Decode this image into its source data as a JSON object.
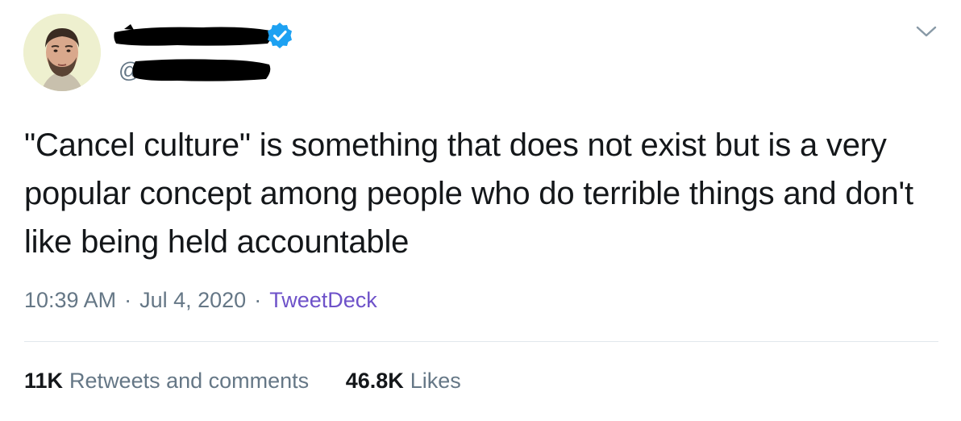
{
  "tweet": {
    "author": {
      "handle_prefix": "@",
      "verified_icon": "verified-badge-icon",
      "avatar_icon": "profile-photo"
    },
    "menu_icon": "chevron-down-icon",
    "text": "\"Cancel culture\" is something that does not exist but is a very popular concept among people who do terrible things and don't like being held accountable",
    "time": "10:39 AM",
    "separator": "·",
    "date": "Jul 4, 2020",
    "source": "TweetDeck",
    "stats": {
      "retweets_count": "11K",
      "retweets_label": "Retweets and comments",
      "likes_count": "46.8K",
      "likes_label": "Likes"
    }
  },
  "colors": {
    "text": "#14171a",
    "muted": "#657786",
    "source_link": "#6e52c9",
    "verified": "#1da1f2",
    "divider": "#e1e8ed"
  }
}
